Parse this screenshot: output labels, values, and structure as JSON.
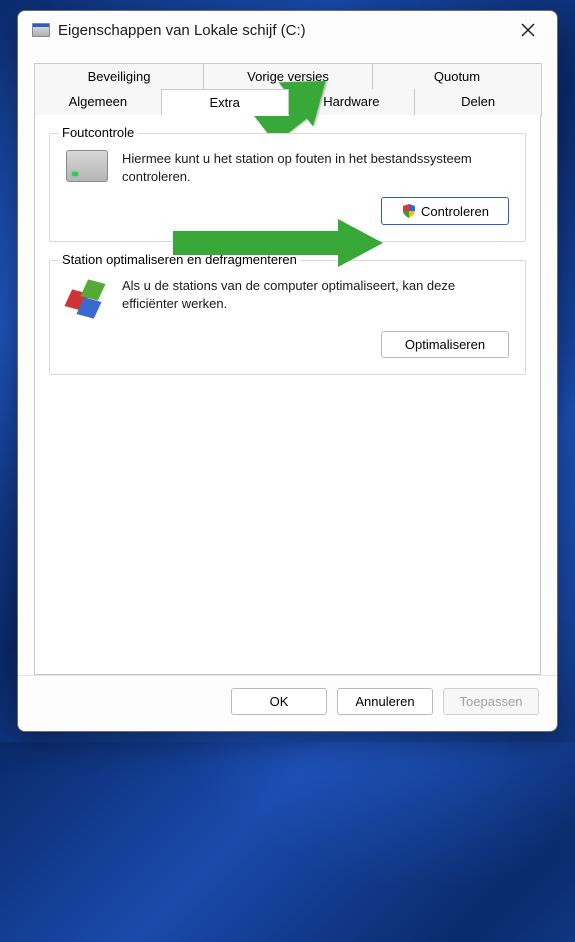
{
  "window": {
    "title": "Eigenschappen van Lokale schijf (C:)"
  },
  "tabs": {
    "row1": [
      {
        "label": "Beveiliging"
      },
      {
        "label": "Vorige versies"
      },
      {
        "label": "Quotum"
      }
    ],
    "row2": [
      {
        "label": "Algemeen"
      },
      {
        "label": "Extra"
      },
      {
        "label": "Hardware"
      },
      {
        "label": "Delen"
      }
    ],
    "active": "Extra"
  },
  "group_errorcheck": {
    "title": "Foutcontrole",
    "description": "Hiermee kunt u het station op fouten in het bestandssysteem controleren.",
    "button": "Controleren"
  },
  "group_optimize": {
    "title": "Station optimaliseren en defragmenteren",
    "description": "Als u de stations van de computer optimaliseert, kan deze efficiënter werken.",
    "button": "Optimaliseren"
  },
  "buttons": {
    "ok": "OK",
    "cancel": "Annuleren",
    "apply": "Toepassen"
  }
}
